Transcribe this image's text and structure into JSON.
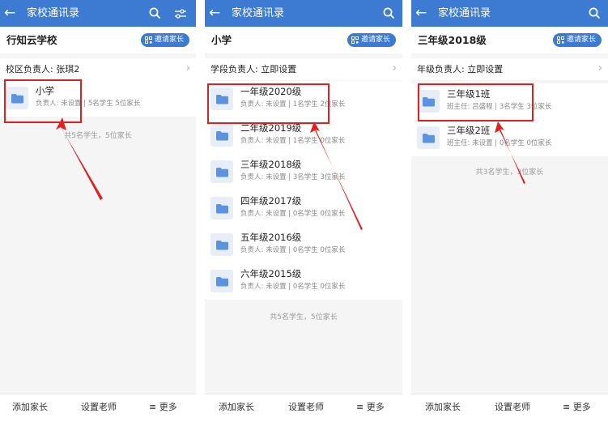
{
  "screens": [
    {
      "header_title": "家校通讯录",
      "subheader_title": "行知云学校",
      "invite_label": "邀请家长",
      "leader_label": "校区负责人: 张琪2",
      "items": [
        {
          "name": "小学",
          "detail": "负责人: 未设置 | 5名学生 5位家长"
        }
      ],
      "summary": "共5名学生，5位家长",
      "bottom": {
        "add_parent": "添加家长",
        "set_teacher": "设置老师",
        "more": "更多"
      }
    },
    {
      "header_title": "家校通讯录",
      "subheader_title": "小学",
      "invite_label": "邀请家长",
      "leader_label": "学段负责人: 立即设置",
      "items": [
        {
          "name": "一年级2020级",
          "detail": "负责人: 未设置 | 1名学生 2位家长"
        },
        {
          "name": "二年级2019级",
          "detail": "负责人: 未设置 | 1名学生 0位家长"
        },
        {
          "name": "三年级2018级",
          "detail": "负责人: 未设置 | 3名学生 3位家长"
        },
        {
          "name": "四年级2017级",
          "detail": "负责人: 未设置 | 0名学生 0位家长"
        },
        {
          "name": "五年级2016级",
          "detail": "负责人: 未设置 | 0名学生 0位家长"
        },
        {
          "name": "六年级2015级",
          "detail": "负责人: 未设置 | 0名学生 0位家长"
        }
      ],
      "summary": "共5名学生，5位家长",
      "bottom": {
        "add_parent": "添加家长",
        "set_teacher": "设置老师",
        "more": "更多"
      }
    },
    {
      "header_title": "家校通讯录",
      "subheader_title": "三年级2018级",
      "invite_label": "邀请家长",
      "leader_label": "年级负责人: 立即设置",
      "items": [
        {
          "name": "三年级1班",
          "detail": "班主任: 吕盛程 | 3名学生 3位家长"
        },
        {
          "name": "三年级2班",
          "detail": "班主任: 未设置 | 0名学生 0位家长"
        }
      ],
      "summary": "共3名学生，3位家长",
      "bottom": {
        "add_parent": "添加家长",
        "set_teacher": "设置老师",
        "more": "更多"
      }
    }
  ],
  "colors": {
    "header_bg": "#3d7bd3",
    "highlight": "#e02020",
    "folder": "#5b93de"
  }
}
